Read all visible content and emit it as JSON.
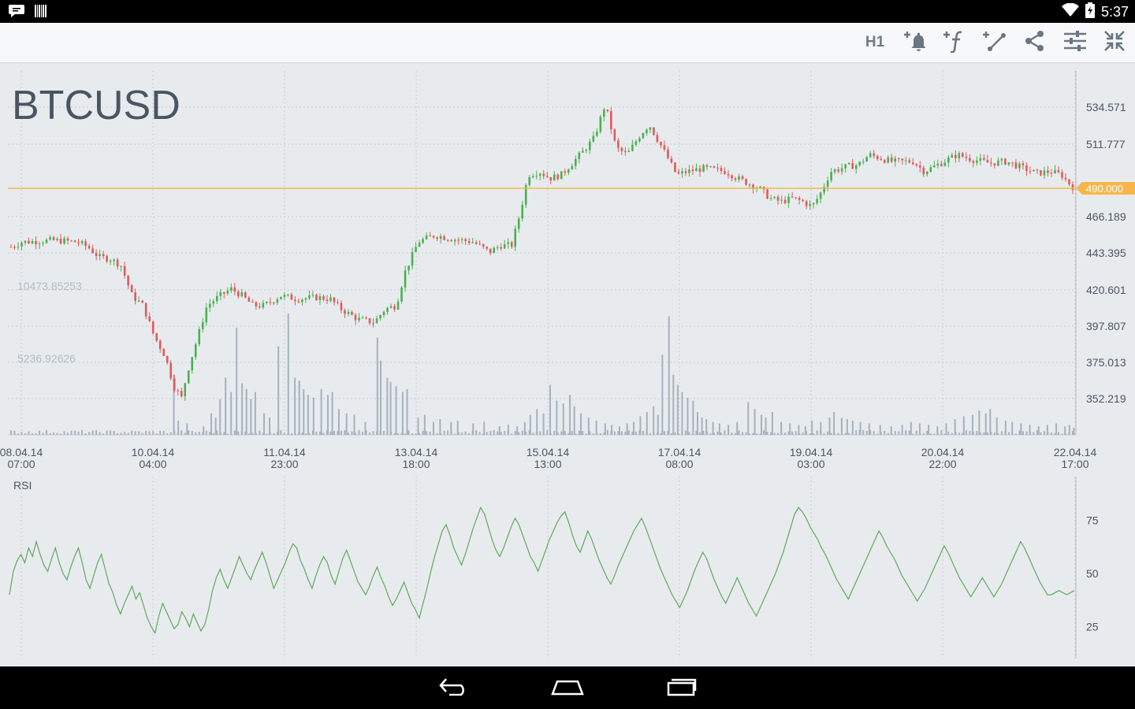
{
  "status_bar": {
    "time": "5:37"
  },
  "toolbar": {
    "timeframe": "H1"
  },
  "chart": {
    "symbol": "BTCUSD",
    "current_price_label": "490.000",
    "volume_labels": [
      "10473.85253",
      "5236.92626"
    ],
    "rsi_label": "RSI",
    "colors": {
      "up": "#4caf50",
      "down": "#e05a5a",
      "price_line": "#f6b64c",
      "volume": "#a5b1be",
      "rsi_line": "#5fa85f",
      "background": "#e8ebee"
    }
  },
  "chart_data": [
    {
      "type": "candlestick",
      "title": "BTCUSD",
      "y_ticks": [
        "534.571",
        "511.777",
        "466.189",
        "443.395",
        "420.601",
        "397.807",
        "375.013",
        "352.219"
      ],
      "x_ticks": [
        {
          "date": "08.04.14",
          "time": "07:00"
        },
        {
          "date": "10.04.14",
          "time": "04:00"
        },
        {
          "date": "11.04.14",
          "time": "23:00"
        },
        {
          "date": "13.04.14",
          "time": "18:00"
        },
        {
          "date": "15.04.14",
          "time": "13:00"
        },
        {
          "date": "17.04.14",
          "time": "08:00"
        },
        {
          "date": "19.04.14",
          "time": "03:00"
        },
        {
          "date": "20.04.14",
          "time": "22:00"
        },
        {
          "date": "22.04.14",
          "time": "17:00"
        }
      ],
      "ylim": [
        343,
        560
      ],
      "horizontal_line": 490.0,
      "price_path": [
        [
          0,
          455
        ],
        [
          10,
          458
        ],
        [
          40,
          459
        ],
        [
          60,
          458
        ],
        [
          70,
          455
        ],
        [
          80,
          449
        ],
        [
          90,
          448
        ],
        [
          100,
          444
        ],
        [
          110,
          426
        ],
        [
          120,
          420
        ],
        [
          130,
          402
        ],
        [
          140,
          390
        ],
        [
          148,
          372
        ],
        [
          155,
          365
        ],
        [
          160,
          380
        ],
        [
          170,
          402
        ],
        [
          178,
          420
        ],
        [
          190,
          426
        ],
        [
          200,
          430
        ],
        [
          210,
          426
        ],
        [
          220,
          420
        ],
        [
          230,
          420
        ],
        [
          245,
          426
        ],
        [
          260,
          424
        ],
        [
          278,
          425
        ],
        [
          290,
          424
        ],
        [
          300,
          418
        ],
        [
          315,
          412
        ],
        [
          330,
          410
        ],
        [
          340,
          418
        ],
        [
          350,
          420
        ],
        [
          358,
          440
        ],
        [
          370,
          458
        ],
        [
          385,
          462
        ],
        [
          400,
          460
        ],
        [
          420,
          458
        ],
        [
          435,
          452
        ],
        [
          445,
          456
        ],
        [
          455,
          456
        ],
        [
          463,
          476
        ],
        [
          470,
          498
        ],
        [
          480,
          500
        ],
        [
          490,
          496
        ],
        [
          500,
          498
        ],
        [
          510,
          505
        ],
        [
          520,
          512
        ],
        [
          530,
          520
        ],
        [
          540,
          540
        ],
        [
          550,
          514
        ],
        [
          560,
          510
        ],
        [
          572,
          522
        ],
        [
          580,
          528
        ],
        [
          592,
          514
        ],
        [
          605,
          498
        ],
        [
          615,
          500
        ],
        [
          630,
          502
        ],
        [
          650,
          500
        ],
        [
          660,
          496
        ],
        [
          670,
          493
        ],
        [
          680,
          490
        ],
        [
          690,
          484
        ],
        [
          700,
          482
        ],
        [
          710,
          484
        ],
        [
          720,
          482
        ],
        [
          728,
          479
        ],
        [
          735,
          486
        ],
        [
          745,
          500
        ],
        [
          760,
          503
        ],
        [
          770,
          504
        ],
        [
          780,
          510
        ],
        [
          790,
          508
        ],
        [
          800,
          506
        ],
        [
          820,
          506
        ],
        [
          830,
          500
        ],
        [
          845,
          505
        ],
        [
          860,
          510
        ],
        [
          875,
          507
        ],
        [
          890,
          505
        ],
        [
          905,
          506
        ],
        [
          920,
          502
        ],
        [
          932,
          499
        ],
        [
          945,
          500
        ],
        [
          955,
          498
        ],
        [
          960,
          494
        ],
        [
          965,
          491
        ]
      ],
      "volume": {
        "max": 10473.85253,
        "spikes": [
          [
            148,
            4200
          ],
          [
            152,
            1000
          ],
          [
            160,
            800
          ],
          [
            175,
            600
          ],
          [
            182,
            1500
          ],
          [
            186,
            1200
          ],
          [
            190,
            2500
          ],
          [
            195,
            4000
          ],
          [
            200,
            3000
          ],
          [
            205,
            7500
          ],
          [
            210,
            3600
          ],
          [
            214,
            3200
          ],
          [
            218,
            2500
          ],
          [
            222,
            3000
          ],
          [
            230,
            1500
          ],
          [
            235,
            1200
          ],
          [
            243,
            6200
          ],
          [
            252,
            8500
          ],
          [
            258,
            4000
          ],
          [
            262,
            3800
          ],
          [
            266,
            3200
          ],
          [
            270,
            2800
          ],
          [
            275,
            2600
          ],
          [
            282,
            3200
          ],
          [
            288,
            2800
          ],
          [
            292,
            3000
          ],
          [
            298,
            1800
          ],
          [
            305,
            1500
          ],
          [
            312,
            1400
          ],
          [
            322,
            900
          ],
          [
            333,
            6800
          ],
          [
            336,
            5200
          ],
          [
            342,
            4000
          ],
          [
            345,
            3700
          ],
          [
            350,
            3400
          ],
          [
            356,
            3000
          ],
          [
            360,
            3200
          ],
          [
            370,
            1200
          ],
          [
            376,
            1400
          ],
          [
            384,
            900
          ],
          [
            390,
            1100
          ],
          [
            400,
            900
          ],
          [
            406,
            1000
          ],
          [
            420,
            800
          ],
          [
            430,
            900
          ],
          [
            444,
            600
          ],
          [
            452,
            700
          ],
          [
            460,
            600
          ],
          [
            467,
            900
          ],
          [
            472,
            1400
          ],
          [
            478,
            1800
          ],
          [
            484,
            1500
          ],
          [
            490,
            3500
          ],
          [
            496,
            2400
          ],
          [
            502,
            2200
          ],
          [
            508,
            2800
          ],
          [
            512,
            2000
          ],
          [
            518,
            1500
          ],
          [
            525,
            1200
          ],
          [
            532,
            1000
          ],
          [
            540,
            800
          ],
          [
            546,
            700
          ],
          [
            553,
            600
          ],
          [
            560,
            800
          ],
          [
            566,
            900
          ],
          [
            572,
            1300
          ],
          [
            578,
            1600
          ],
          [
            584,
            2000
          ],
          [
            588,
            1400
          ],
          [
            592,
            5600
          ],
          [
            598,
            8300
          ],
          [
            602,
            4200
          ],
          [
            606,
            3500
          ],
          [
            610,
            3000
          ],
          [
            615,
            2600
          ],
          [
            620,
            2400
          ],
          [
            624,
            1600
          ],
          [
            628,
            1200
          ],
          [
            632,
            1100
          ],
          [
            638,
            900
          ],
          [
            644,
            800
          ],
          [
            652,
            700
          ],
          [
            660,
            900
          ],
          [
            670,
            2300
          ],
          [
            676,
            1800
          ],
          [
            682,
            1400
          ],
          [
            686,
            1200
          ],
          [
            692,
            1600
          ],
          [
            700,
            900
          ],
          [
            708,
            800
          ],
          [
            716,
            700
          ],
          [
            722,
            600
          ],
          [
            728,
            1000
          ],
          [
            736,
            900
          ],
          [
            744,
            1200
          ],
          [
            748,
            1600
          ],
          [
            755,
            1200
          ],
          [
            760,
            1100
          ],
          [
            765,
            1000
          ],
          [
            772,
            900
          ],
          [
            780,
            800
          ],
          [
            790,
            700
          ],
          [
            800,
            600
          ],
          [
            810,
            700
          ],
          [
            818,
            900
          ],
          [
            826,
            800
          ],
          [
            834,
            700
          ],
          [
            842,
            600
          ],
          [
            850,
            800
          ],
          [
            858,
            1100
          ],
          [
            866,
            1300
          ],
          [
            874,
            1400
          ],
          [
            880,
            1700
          ],
          [
            886,
            1500
          ],
          [
            890,
            1800
          ],
          [
            896,
            1200
          ],
          [
            904,
            1000
          ],
          [
            910,
            900
          ],
          [
            918,
            800
          ],
          [
            926,
            700
          ],
          [
            934,
            600
          ],
          [
            942,
            700
          ],
          [
            950,
            800
          ],
          [
            958,
            600
          ],
          [
            962,
            700
          ],
          [
            966,
            500
          ]
        ]
      }
    },
    {
      "type": "line",
      "title": "RSI",
      "y_ticks": [
        "75",
        "50",
        "25"
      ],
      "ylim": [
        10,
        90
      ],
      "values": [
        40,
        51,
        56,
        59,
        55,
        62,
        58,
        65,
        59,
        54,
        51,
        57,
        62,
        55,
        50,
        47,
        53,
        58,
        62,
        55,
        47,
        43,
        49,
        55,
        59,
        52,
        45,
        41,
        35,
        31,
        36,
        40,
        44,
        38,
        41,
        35,
        29,
        25,
        22,
        30,
        36,
        32,
        28,
        24,
        26,
        32,
        29,
        25,
        31,
        27,
        23,
        26,
        33,
        42,
        48,
        52,
        47,
        43,
        48,
        53,
        58,
        54,
        50,
        47,
        52,
        56,
        60,
        55,
        49,
        43,
        47,
        51,
        55,
        60,
        64,
        62,
        56,
        52,
        47,
        43,
        49,
        54,
        58,
        55,
        49,
        45,
        51,
        57,
        61,
        56,
        51,
        46,
        43,
        40,
        44,
        49,
        53,
        48,
        44,
        39,
        35,
        38,
        42,
        46,
        41,
        36,
        33,
        29,
        36,
        43,
        51,
        58,
        64,
        70,
        73,
        68,
        62,
        58,
        54,
        59,
        65,
        71,
        76,
        81,
        78,
        72,
        66,
        61,
        58,
        62,
        67,
        72,
        76,
        73,
        68,
        63,
        58,
        55,
        51,
        56,
        61,
        66,
        70,
        74,
        77,
        79,
        74,
        68,
        63,
        60,
        65,
        70,
        66,
        61,
        56,
        52,
        48,
        45,
        49,
        54,
        58,
        62,
        66,
        70,
        73,
        76,
        72,
        67,
        62,
        57,
        52,
        48,
        44,
        40,
        37,
        34,
        38,
        42,
        47,
        52,
        56,
        60,
        57,
        52,
        47,
        43,
        39,
        36,
        40,
        44,
        48,
        44,
        40,
        36,
        33,
        30,
        34,
        38,
        42,
        46,
        50,
        55,
        60,
        66,
        72,
        78,
        81,
        79,
        76,
        72,
        69,
        66,
        62,
        59,
        55,
        51,
        47,
        44,
        41,
        38,
        42,
        46,
        50,
        54,
        58,
        62,
        66,
        70,
        67,
        63,
        60,
        57,
        53,
        49,
        46,
        43,
        40,
        37,
        40,
        43,
        47,
        51,
        55,
        59,
        63,
        60,
        56,
        52,
        48,
        45,
        42,
        39,
        42,
        45,
        48,
        45,
        42,
        39,
        42,
        45,
        49,
        53,
        57,
        61,
        65,
        62,
        58,
        54,
        50,
        46,
        43,
        40,
        40,
        41,
        42,
        41,
        40,
        41,
        42
      ]
    }
  ]
}
